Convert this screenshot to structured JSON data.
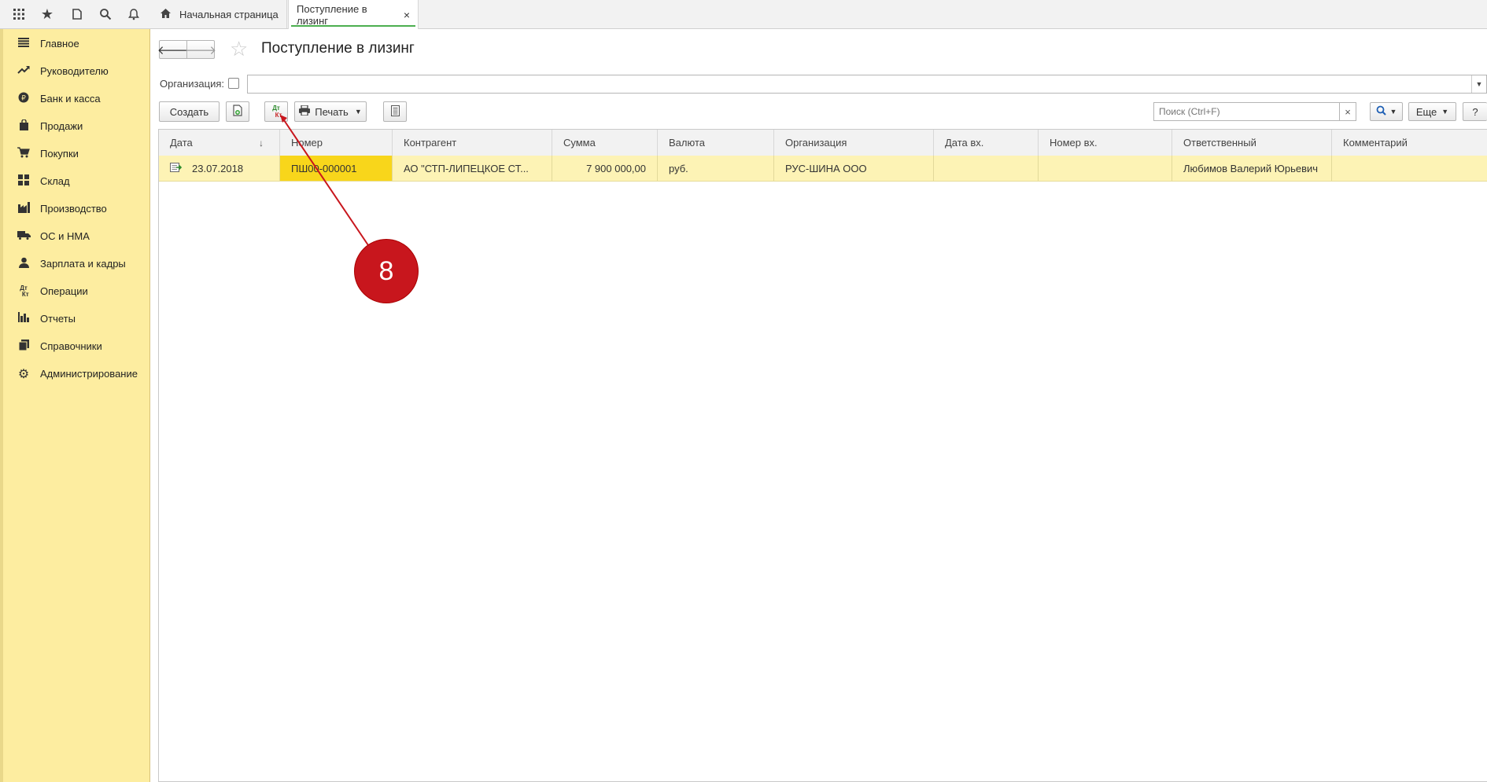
{
  "tabs": {
    "home_label": "Начальная страница",
    "active_label": "Поступление в лизинг",
    "close": "×"
  },
  "sidebar": {
    "items": [
      {
        "label": "Главное",
        "icon": "menu-lines-icon"
      },
      {
        "label": "Руководителю",
        "icon": "trend-icon"
      },
      {
        "label": "Банк и касса",
        "icon": "ruble-coin-icon"
      },
      {
        "label": "Продажи",
        "icon": "shopping-bag-icon"
      },
      {
        "label": "Покупки",
        "icon": "cart-icon"
      },
      {
        "label": "Склад",
        "icon": "grid-blocks-icon"
      },
      {
        "label": "Производство",
        "icon": "factory-icon"
      },
      {
        "label": "ОС и НМА",
        "icon": "truck-icon"
      },
      {
        "label": "Зарплата и кадры",
        "icon": "person-icon"
      },
      {
        "label": "Операции",
        "icon": "dt-kt-icon"
      },
      {
        "label": "Отчеты",
        "icon": "bar-chart-icon"
      },
      {
        "label": "Справочники",
        "icon": "books-icon"
      },
      {
        "label": "Администрирование",
        "icon": "gear-icon"
      }
    ]
  },
  "header": {
    "title": "Поступление в лизинг"
  },
  "filter": {
    "org_label": "Организация:"
  },
  "toolbar": {
    "create_label": "Создать",
    "dtkt_top": "Дт",
    "dtkt_bottom": "Кт",
    "print_label": "Печать",
    "search_placeholder": "Поиск (Ctrl+F)",
    "search_clear": "×",
    "more_label": "Еще",
    "help_label": "?"
  },
  "table": {
    "columns": [
      "Дата",
      "Номер",
      "Контрагент",
      "Сумма",
      "Валюта",
      "Организация",
      "Дата вх.",
      "Номер вх.",
      "Ответственный",
      "Комментарий"
    ],
    "rows": [
      {
        "date": "23.07.2018",
        "number": "ПШ00-000001",
        "counterparty": "АО \"СТП-ЛИПЕЦКОЕ СТ...",
        "sum": "7 900 000,00",
        "currency": "руб.",
        "organization": "РУС-ШИНА ООО",
        "date_in": "",
        "number_in": "",
        "responsible": "Любимов Валерий Юрьевич",
        "comment": ""
      }
    ]
  },
  "annotation": {
    "badge": "8",
    "color": "#c8161d"
  }
}
